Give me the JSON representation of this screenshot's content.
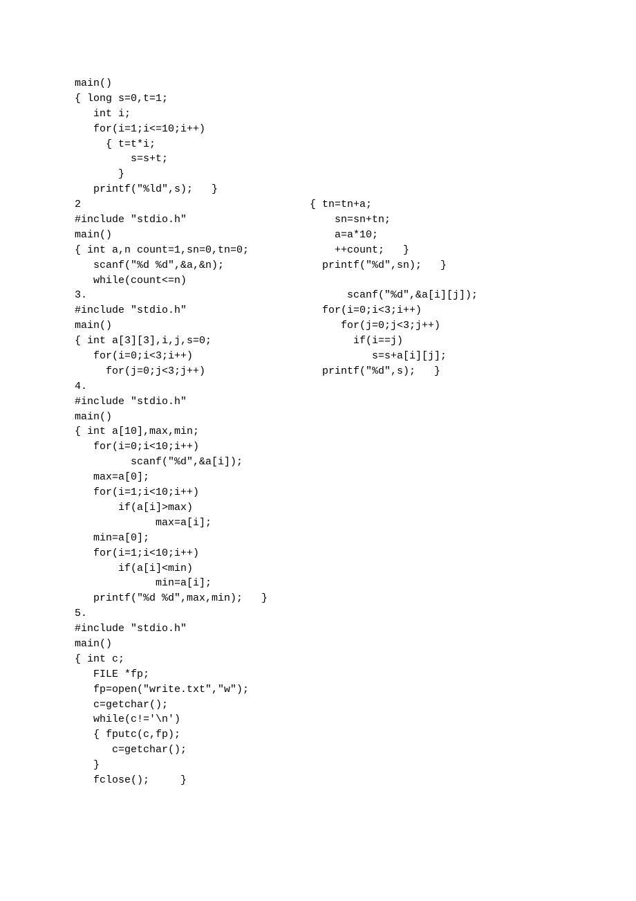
{
  "code1": "main()\n{ long s=0,t=1;\n   int i;\n   for(i=1;i<=10;i++)\n     { t=t*i;\n         s=s+t;\n       }\n   printf(\"%ld\",s);   }",
  "label2": "2",
  "code2_left": "#include \"stdio.h\"\nmain()\n{ int a,n count=1,sn=0,tn=0;\n   scanf(\"%d %d\",&a,&n);\n   while(count<=n)",
  "code2_right": "{ tn=tn+a;\n    sn=sn+tn;\n    a=a*10;\n    ++count;   }\n  printf(\"%d\",sn);   }",
  "label3": "3.",
  "code3_left": "#include \"stdio.h\"\nmain()\n{ int a[3][3],i,j,s=0;\n   for(i=0;i<3;i++)\n     for(j=0;j<3;j++)",
  "code3_right": "      scanf(\"%d\",&a[i][j]);\n  for(i=0;i<3;i++)\n     for(j=0;j<3;j++)\n       if(i==j)\n          s=s+a[i][j];\n  printf(\"%d\",s);   }",
  "label4": "4.",
  "code4": "#include \"stdio.h\"\nmain()\n{ int a[10],max,min;\n   for(i=0;i<10;i++)\n         scanf(\"%d\",&a[i]);\n   max=a[0];\n   for(i=1;i<10;i++)\n       if(a[i]>max)\n             max=a[i];\n   min=a[0];\n   for(i=1;i<10;i++)\n       if(a[i]<min)\n             min=a[i];\n   printf(\"%d %d\",max,min);   }",
  "label5": "5.",
  "code5": "#include \"stdio.h\"\nmain()\n{ int c;\n   FILE *fp;\n   fp=open(\"write.txt\",\"w\");\n   c=getchar();\n   while(c!='\\n')\n   { fputc(c,fp);\n      c=getchar();\n   }\n   fclose();     }"
}
